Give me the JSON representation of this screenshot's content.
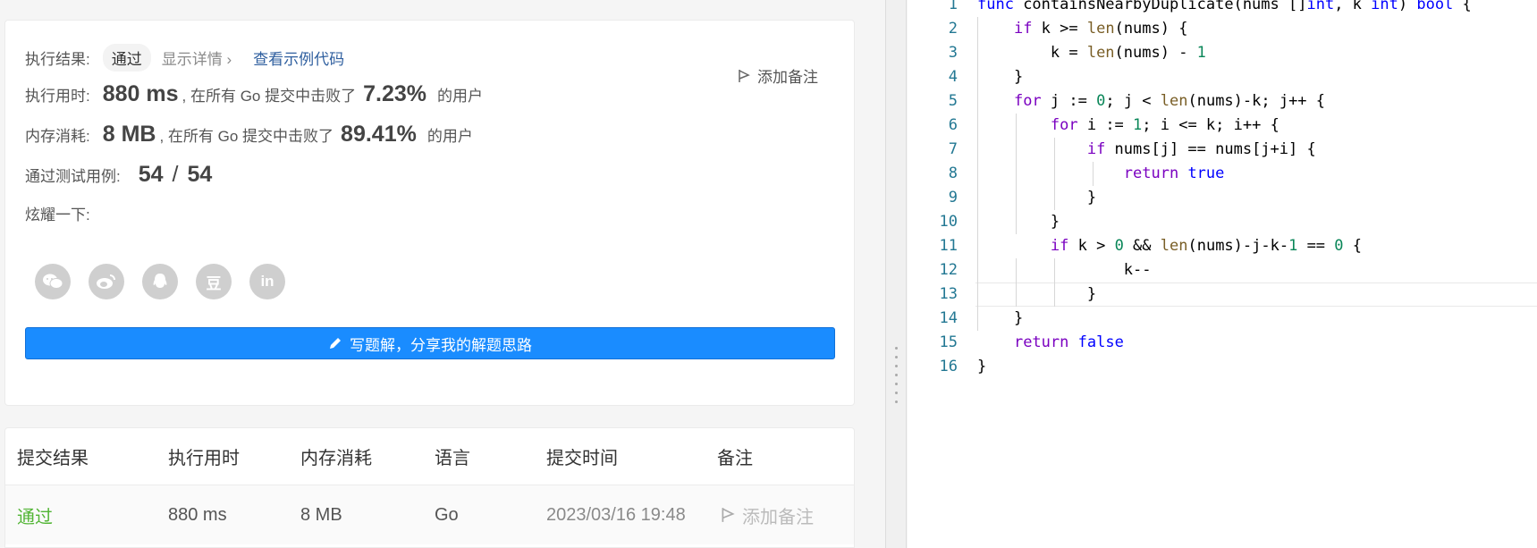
{
  "result": {
    "status_label": "执行结果:",
    "status_value": "通过",
    "show_details": "显示详情",
    "view_sample": "查看示例代码",
    "add_note": "添加备注",
    "runtime_label": "执行用时:",
    "runtime_value": "880 ms",
    "runtime_text": ", 在所有 Go 提交中击败了",
    "runtime_pct": "7.23%",
    "users_suffix": "的用户",
    "memory_label": "内存消耗:",
    "memory_value": "8 MB",
    "memory_text": ", 在所有 Go 提交中击败了",
    "memory_pct": "89.41%",
    "tests_label": "通过测试用例:",
    "tests_passed": "54",
    "tests_sep": "/",
    "tests_total": "54",
    "share_label": "炫耀一下:",
    "share_icons": [
      "wechat-icon",
      "weibo-icon",
      "qq-icon",
      "douban-icon",
      "linkedin-icon"
    ],
    "douban_glyph": "豆",
    "linkedin_glyph": "in",
    "solution_button": "写题解，分享我的解题思路"
  },
  "submissions": {
    "headers": [
      "提交结果",
      "执行用时",
      "内存消耗",
      "语言",
      "提交时间",
      "备注"
    ],
    "rows": [
      {
        "result": "通过",
        "runtime": "880 ms",
        "memory": "8 MB",
        "language": "Go",
        "time": "2023/03/16 19:48",
        "note": "添加备注"
      }
    ]
  },
  "editor": {
    "line_numbers": [
      "1",
      "2",
      "3",
      "4",
      "5",
      "6",
      "7",
      "8",
      "9",
      "10",
      "11",
      "12",
      "13",
      "14",
      "15",
      "16"
    ],
    "lines": [
      "func containsNearbyDuplicate(nums []int, k int) bool {",
      "    if k >= len(nums) {",
      "        k = len(nums) - 1",
      "    }",
      "    for j := 0; j < len(nums)-k; j++ {",
      "        for i := 1; i <= k; i++ {",
      "            if nums[j] == nums[j+i] {",
      "                return true",
      "            }",
      "        }",
      "        if k > 0 && len(nums)-j-k-1 == 0 {",
      "                k--",
      "            }",
      "    }",
      "    return false",
      "}"
    ]
  },
  "colors": {
    "primary_button": "#1a8cff",
    "success": "#52b535",
    "link": "#2f5f9f",
    "line_number": "#237893"
  }
}
